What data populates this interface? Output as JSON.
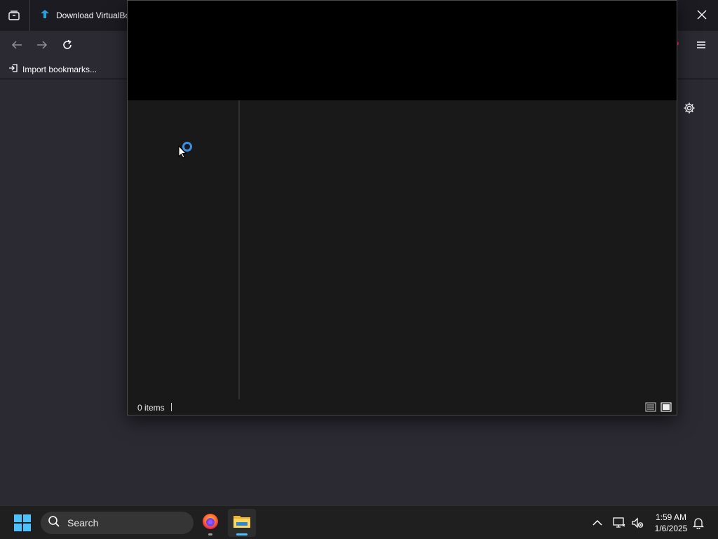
{
  "browser": {
    "tab_title": "Download VirtualBo",
    "bookmarks_toolbar": {
      "import_label": "Import bookmarks..."
    }
  },
  "explorer": {
    "status_text": "0 items"
  },
  "taskbar": {
    "search_label": "Search",
    "clock_time": "1:59 AM",
    "clock_date": "1/6/2025"
  },
  "colors": {
    "browser_bg": "#2b2a33",
    "tabbar_bg": "#1c1b22",
    "explorer_bg": "#191919",
    "spinner": "#3a8ee6",
    "taskbar_bg": "#1f1f1f"
  },
  "icons": {
    "tab_list": "list-all-tabs-icon",
    "tab_favicon": "virtualbox-download-icon",
    "back": "arrow-left-icon",
    "forward": "arrow-right-icon",
    "reload": "reload-icon",
    "menu": "hamburger-menu-icon",
    "close": "close-icon",
    "import": "import-icon",
    "settings": "gear-icon",
    "start": "windows-start-icon",
    "search": "search-icon",
    "firefox": "firefox-icon",
    "file_explorer": "file-explorer-icon",
    "tray_overflow": "chevron-up-icon",
    "network": "network-icon",
    "volume": "speaker-muted-icon",
    "notifications": "bell-icon"
  }
}
